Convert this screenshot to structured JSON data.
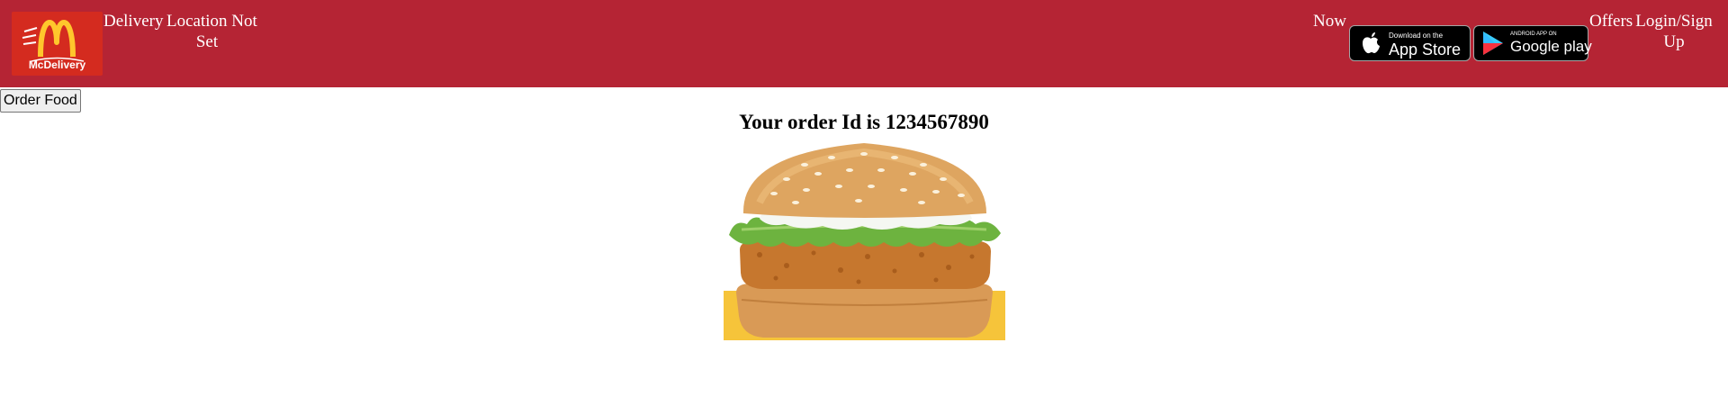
{
  "header": {
    "logo": {
      "icon": "golden-arches-icon",
      "text": "McDelivery"
    },
    "nav": {
      "delivery": "Delivery",
      "location_line1": "Location Not",
      "location_line2": "Set",
      "now": "Now",
      "offers": "Offers",
      "login_line1": "Login/Sign",
      "login_line2": "Up"
    },
    "app_store": {
      "small": "Download on the",
      "big": "App Store",
      "icon": "apple-icon"
    },
    "google_play": {
      "small": "ANDROID APP ON",
      "big": "Google play",
      "icon": "play-triangle-icon"
    }
  },
  "main": {
    "order_button": "Order Food",
    "order_message": "Your order Id is 1234567890",
    "image": "burger-image"
  },
  "colors": {
    "header_bg": "#b52434",
    "logo_bg": "#d42b1f",
    "arches": "#ffc72c"
  }
}
